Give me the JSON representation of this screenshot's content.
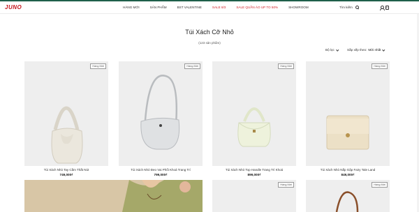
{
  "brand": {
    "logo": "JUNO"
  },
  "nav": {
    "items": [
      {
        "label": "HÀNG MỚI",
        "red": false
      },
      {
        "label": "SẢN PHẨM",
        "red": false
      },
      {
        "label": "BST VALENTINE",
        "red": false
      },
      {
        "label": "SALE 8/3",
        "red": true
      },
      {
        "label": "SALE QUẦN ÁO UP TO 50%",
        "red": true
      },
      {
        "label": "SHOWROOM",
        "red": false
      }
    ],
    "search_label": "Tìm kiếm",
    "cart_count": "0"
  },
  "page": {
    "title": "Túi Xách Cỡ Nhỏ",
    "count": "(123 sản phẩm)",
    "filter_label": "Bộ lọc",
    "sort_label": "Sắp xếp theo:",
    "sort_value": "Mới nhất"
  },
  "products": [
    {
      "badge": "Hàng Mới",
      "name": "Túi Xách Nhỏ Tay Cầm Thắt Nút",
      "price": "749,000₫",
      "icon": "handbag-white-knot"
    },
    {
      "badge": "Hàng Mới",
      "name": "Túi Xách Nhỏ Đeo Vai Phối Khoá Trang Trí",
      "price": "799,000₫",
      "icon": "handbag-silver-shoulder"
    },
    {
      "badge": "Hàng Mới",
      "name": "Túi Xách Nhỏ Top Handle Trang Trí Khoá",
      "price": "899,000₫",
      "icon": "handbag-mint-top-handle"
    },
    {
      "badge": "Hàng Mới",
      "name": "Túi Xách Nhỏ Nắp Gập Fairy Tale Land",
      "price": "849,000₫",
      "icon": "handbag-beige-flap"
    },
    {
      "badge": "",
      "name": "",
      "price": "",
      "icon": "model-photo"
    },
    {
      "badge": "",
      "name": "",
      "price": "",
      "icon": "product-photo"
    },
    {
      "badge": "Hàng Mới",
      "name": "",
      "price": "",
      "icon": "product-photo"
    },
    {
      "badge": "Hàng Mới",
      "name": "",
      "price": "",
      "icon": "handbag-brown-strap"
    }
  ]
}
